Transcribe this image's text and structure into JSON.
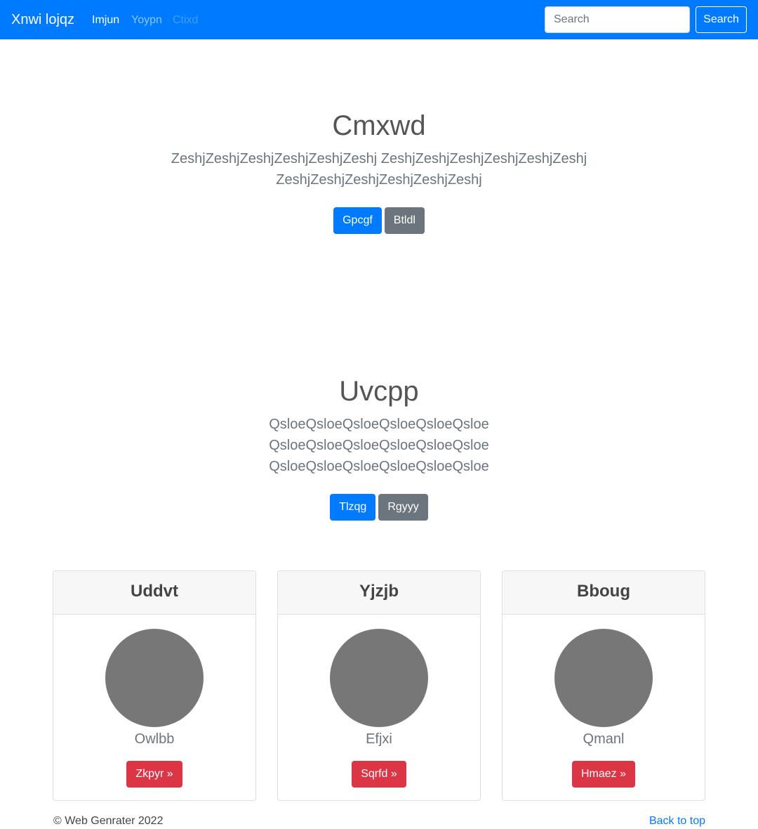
{
  "navbar": {
    "brand": "Xnwi lojqz",
    "links": [
      "Imjun",
      "Yoypn",
      "Ctixd"
    ],
    "search_placeholder": "Search",
    "search_button": "Search",
    "colors": {
      "background": "#007bff"
    }
  },
  "sections": [
    {
      "title": "Cmxwd",
      "lead": "ZeshjZeshjZeshjZeshjZeshjZeshj ZeshjZeshjZeshjZeshjZeshjZeshj ZeshjZeshjZeshjZeshjZeshjZeshj",
      "primary_button": "Gpcgf",
      "secondary_button": "Btldl"
    },
    {
      "title": "Uvcpp",
      "lead": "QsloeQsloeQsloeQsloeQsloeQsloe QsloeQsloeQsloeQsloeQsloeQsloe QsloeQsloeQsloeQsloeQsloeQsloe",
      "primary_button": "Tlzqg",
      "secondary_button": "Rgyyy"
    }
  ],
  "cards": [
    {
      "header": "Uddvt",
      "name": "Owlbb",
      "button": "Zkpyr »"
    },
    {
      "header": "Yjzjb",
      "name": "Efjxi",
      "button": "Sqrfd »"
    },
    {
      "header": "Bboug",
      "name": "Qmanl",
      "button": "Hmaez »"
    }
  ],
  "footer": {
    "copyright": "© Web Genrater 2022",
    "back_to_top": "Back to top"
  }
}
